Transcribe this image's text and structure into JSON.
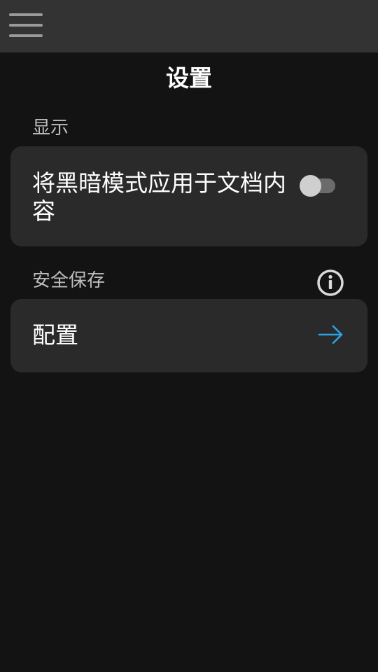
{
  "header": {
    "title": "设置"
  },
  "display_section": {
    "label": "显示",
    "dark_mode_item": {
      "label": "将黑暗模式应用于文档内容",
      "toggle_on": false
    }
  },
  "secure_save_section": {
    "label": "安全保存",
    "info_icon": "info-icon",
    "config_item": {
      "label": "配置",
      "icon": "arrow-right-icon"
    }
  },
  "colors": {
    "background": "#131313",
    "topbar": "#333333",
    "card": "#2a2a2a",
    "accent": "#29a3e8"
  }
}
